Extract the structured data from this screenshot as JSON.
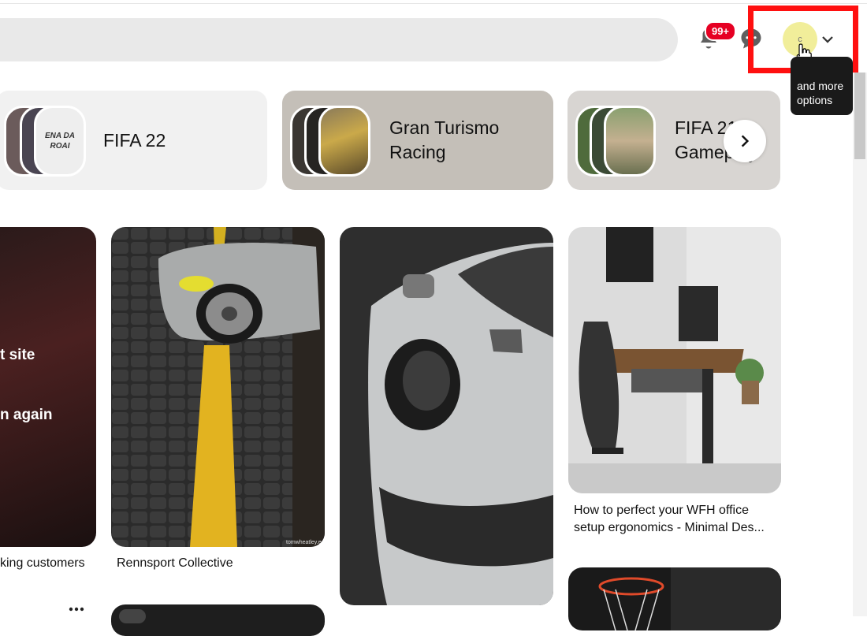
{
  "header": {
    "search_placeholder": "",
    "notifications_badge": "99+",
    "avatar_initial": "c",
    "tooltip_text": "and more options"
  },
  "chips": [
    {
      "label": "FIFA 22",
      "thumb_text": "ENA DA ROAI"
    },
    {
      "label": "Gran Turismo Racing"
    },
    {
      "label": "FIFA 21 Gameplay"
    }
  ],
  "pins": [
    {
      "overlay_line1": "t site",
      "overlay_line2": "n again",
      "caption": "king customers"
    },
    {
      "caption": "Rennsport Collective",
      "watermark": "tomwheatley.e"
    },
    {
      "caption": ""
    },
    {
      "caption": "How to perfect your WFH office setup ergonomics - Minimal Des..."
    }
  ],
  "more_icon": "ellipsis-icon",
  "colors": {
    "accent": "#e60023",
    "highlight": "#ff1010",
    "tooltip_bg": "#1a1a1a"
  }
}
